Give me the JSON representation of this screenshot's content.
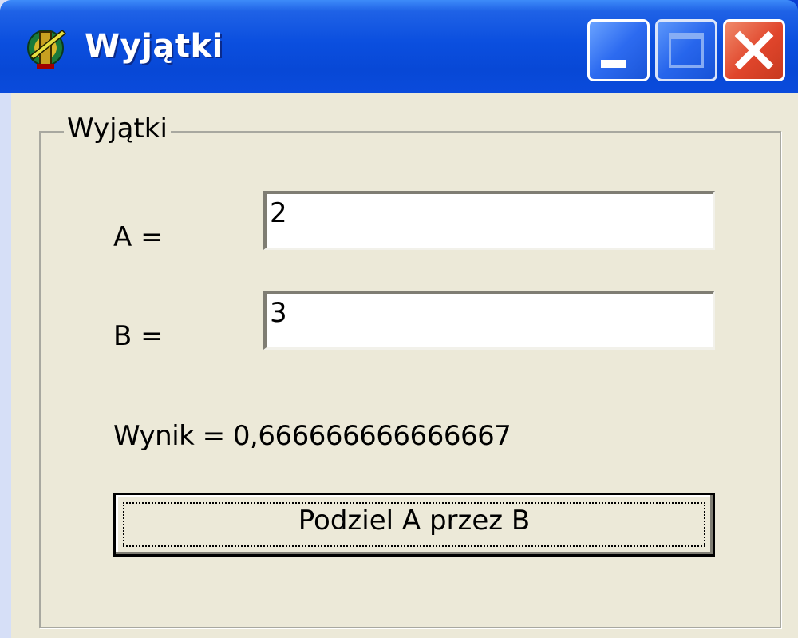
{
  "window": {
    "title": "Wyjątki",
    "app_icon": "delphi-app-icon",
    "controls": {
      "minimize_icon": "minimize-icon",
      "maximize_icon": "maximize-icon",
      "close_icon": "close-icon"
    }
  },
  "groupbox": {
    "legend": "Wyjątki"
  },
  "fields": {
    "a": {
      "label": "A =",
      "value": "2"
    },
    "b": {
      "label": "B =",
      "value": "3"
    }
  },
  "result": {
    "text": "Wynik = 0,666666666666667"
  },
  "divide_button": {
    "label": "Podziel A przez B"
  },
  "colors": {
    "titlebar": "#0a4bdc",
    "client_background": "#ece9d8",
    "close_button": "#e0452b"
  }
}
